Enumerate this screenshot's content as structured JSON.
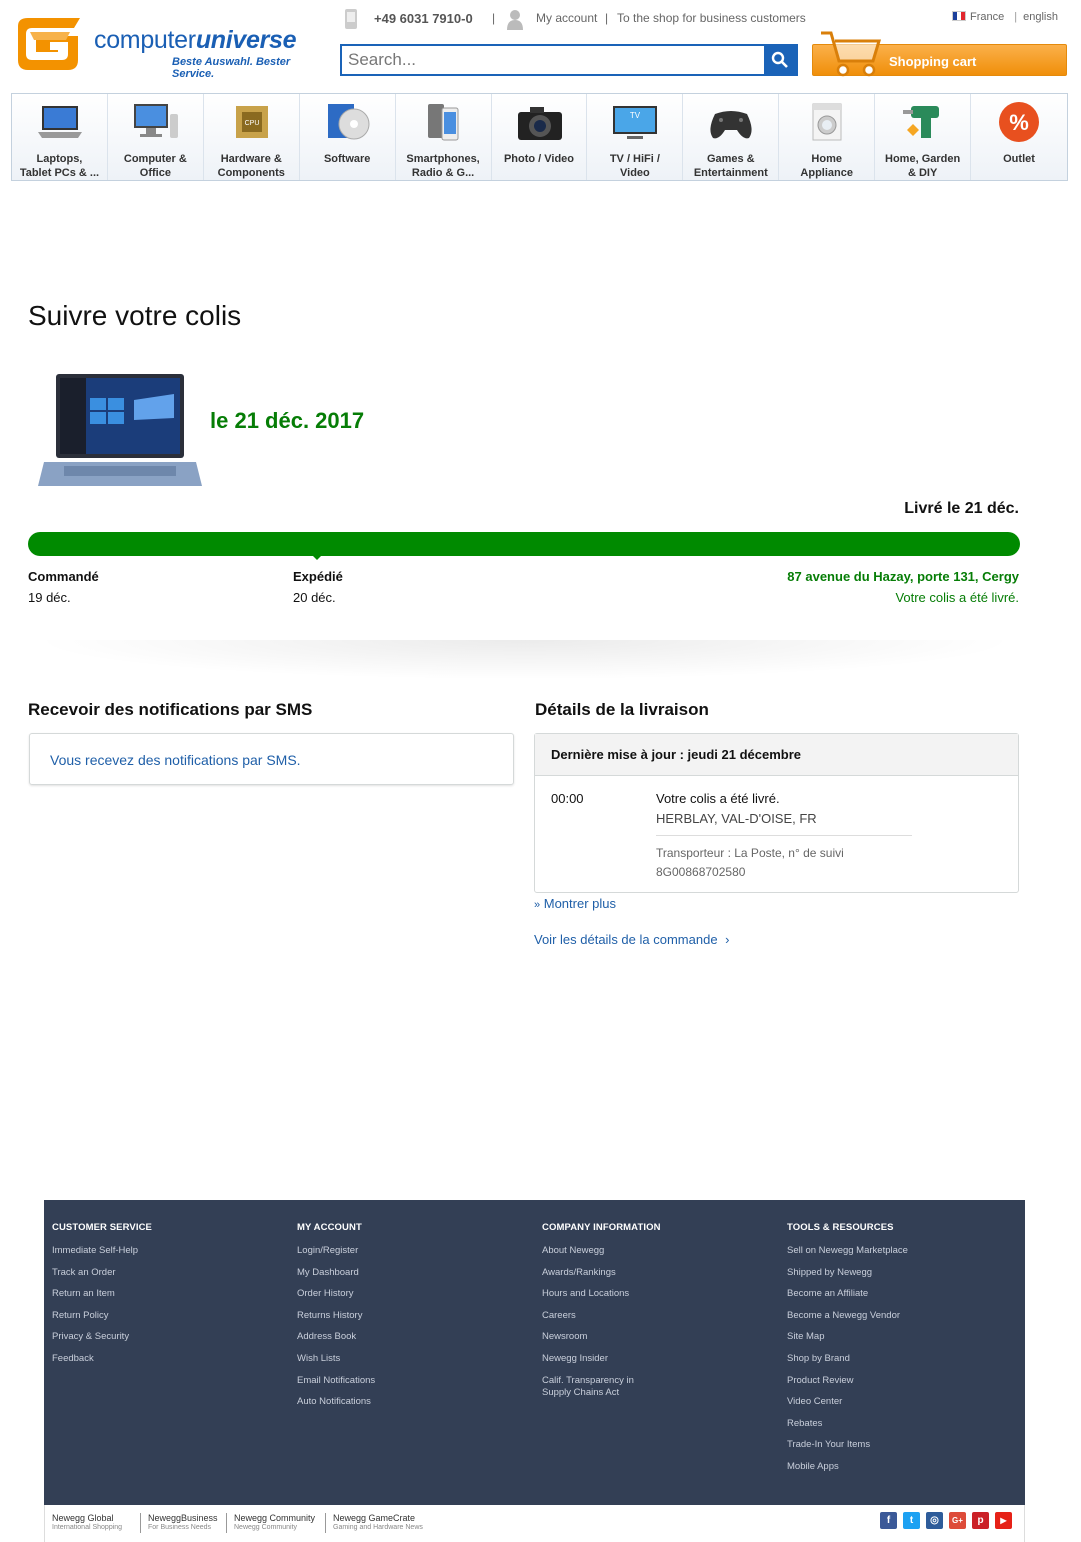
{
  "header": {
    "logo_name_regular": "computer",
    "logo_name_bold": "universe",
    "logo_tagline": "Beste Auswahl. Bester Service.",
    "phone": "+49 6031 7910-0",
    "account_label": "My account",
    "business_label": "To the shop for business customers",
    "country": "France",
    "language": "english",
    "search_placeholder": "Search...",
    "cart_label": "Shopping cart",
    "separator": "|"
  },
  "categories": [
    {
      "line1": "Laptops,",
      "line2": "Tablet PCs & ...",
      "icon": "laptop-icon"
    },
    {
      "line1": "Computer &",
      "line2": "Office",
      "icon": "computer-icon"
    },
    {
      "line1": "Hardware &",
      "line2": "Components",
      "icon": "cpu-icon"
    },
    {
      "line1": "Software",
      "line2": "",
      "icon": "software-icon"
    },
    {
      "line1": "Smartphones,",
      "line2": "Radio & G...",
      "icon": "smartphone-icon"
    },
    {
      "line1": "Photo / Video",
      "line2": "",
      "icon": "camera-icon"
    },
    {
      "line1": "TV / HiFi /",
      "line2": "Video",
      "icon": "tv-icon"
    },
    {
      "line1": "Games &",
      "line2": "Entertainment",
      "icon": "gamepad-icon"
    },
    {
      "line1": "Home",
      "line2": "Appliance",
      "icon": "washing-machine-icon"
    },
    {
      "line1": "Home, Garden",
      "line2": "& DIY",
      "icon": "drill-icon"
    },
    {
      "line1": "Outlet",
      "line2": "",
      "icon": "percent-icon"
    }
  ],
  "tracking": {
    "page_title": "Suivre votre colis",
    "delivery_date": "le 21 déc. 2017",
    "status": "Livré le 21 déc.",
    "progress": 1.0,
    "steps": [
      {
        "label": "Commandé",
        "date": "19 déc."
      },
      {
        "label": "Expédié",
        "date": "20 déc."
      },
      {
        "label": "87 avenue du Hazay, porte 131, Cergy",
        "date": "Votre colis a été livré."
      }
    ]
  },
  "sms": {
    "title": "Recevoir des notifications par SMS",
    "text": "Vous recevez des notifications par SMS."
  },
  "details": {
    "title": "Détails de la livraison",
    "last_update": "Dernière mise à jour : jeudi 21 décembre",
    "event_time": "00:00",
    "event_text": "Votre colis a été livré.",
    "event_location": "HERBLAY, VAL-D'OISE, FR",
    "carrier": "Transporteur : La Poste, n° de suivi",
    "tracking_number": "8G00868702580",
    "show_more": "Montrer plus",
    "order_link": "Voir les détails de la commande",
    "order_chevron": "›",
    "show_more_chevron": "»"
  },
  "footer": {
    "columns": [
      {
        "title": "CUSTOMER SERVICE",
        "links": [
          "Immediate Self-Help",
          "Track an Order",
          "Return an Item",
          "Return Policy",
          "Privacy & Security",
          "Feedback"
        ]
      },
      {
        "title": "MY ACCOUNT",
        "links": [
          "Login/Register",
          "My Dashboard",
          "Order History",
          "Returns History",
          "Address Book",
          "Wish Lists",
          "Email Notifications",
          "Auto Notifications"
        ]
      },
      {
        "title": "COMPANY INFORMATION",
        "links": [
          "About Newegg",
          "Awards/Rankings",
          "Hours and Locations",
          "Careers",
          "Newsroom",
          "Newegg Insider",
          "Calif. Transparency in Supply Chains Act"
        ]
      },
      {
        "title": "TOOLS & RESOURCES",
        "links": [
          "Sell on Newegg Marketplace",
          "Shipped by Newegg",
          "Become an Affiliate",
          "Become a Newegg Vendor",
          "Site Map",
          "Shop by Brand",
          "Product Review",
          "Video Center",
          "Rebates",
          "Trade-In Your Items",
          "Mobile Apps"
        ]
      }
    ],
    "brands": [
      {
        "name": "Newegg Global",
        "sub": "International Shopping"
      },
      {
        "name": "NeweggBusiness",
        "sub": "For Business Needs"
      },
      {
        "name": "Newegg Community",
        "sub": "Newegg Community"
      },
      {
        "name": "Newegg GameCrate",
        "sub": "Gaming and Hardware News"
      }
    ],
    "socials": [
      {
        "icon": "facebook-icon",
        "glyph": "f",
        "color": "#3b5998"
      },
      {
        "icon": "twitter-icon",
        "glyph": "t",
        "color": "#1da1f2"
      },
      {
        "icon": "instagram-icon",
        "glyph": "◎",
        "color": "#2e5c9a"
      },
      {
        "icon": "googleplus-icon",
        "glyph": "G+",
        "color": "#dd4b39"
      },
      {
        "icon": "pinterest-icon",
        "glyph": "p",
        "color": "#cb2027"
      },
      {
        "icon": "youtube-icon",
        "glyph": "▶",
        "color": "#e62117"
      }
    ]
  },
  "colors": {
    "brand_blue": "#1a5fb4",
    "brand_orange": "#f08f0a",
    "success_green": "#008a00",
    "link_blue": "#1f5fa8",
    "footer_bg": "#333f55"
  }
}
